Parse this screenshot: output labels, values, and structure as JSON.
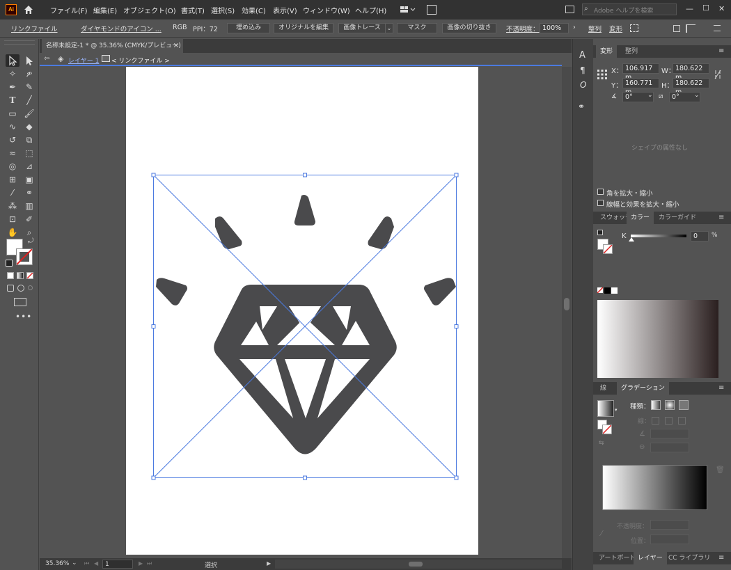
{
  "menubar": {
    "app_icon": "Ai",
    "home_icon": "home-icon",
    "items": [
      "ファイル(F)",
      "編集(E)",
      "オブジェクト(O)",
      "書式(T)",
      "選択(S)",
      "効果(C)",
      "表示(V)",
      "ウィンドウ(W)",
      "ヘルプ(H)"
    ],
    "search_placeholder": "Adobe ヘルプを検索",
    "window_controls": [
      "—",
      "☐",
      "✕"
    ]
  },
  "control_bar": {
    "linked_file": "リンクファイル",
    "file_name": "ダイヤモンドのアイコン ...",
    "color_mode": "RGB",
    "ppi": "PPI：72",
    "embed": "埋め込み",
    "edit_original": "オリジナルを編集",
    "image_trace": "画像トレース",
    "mask": "マスク",
    "crop_image": "画像の切り抜き",
    "opacity_label": "不透明度：",
    "opacity_value": "100%",
    "align": "整列",
    "transform": "変形"
  },
  "document": {
    "tab_title": "名称未設定-1 * @ 35.36% (CMYK/プレビュー)",
    "tab_close": "×",
    "breadcrumb_layer": "レイヤー 1",
    "breadcrumb_item": "< リンクファイル >"
  },
  "statusbar": {
    "zoom": "35.36%",
    "artboard_num": "1",
    "tool_name": "選択"
  },
  "transform_panel": {
    "tabs": [
      "変形",
      "整列"
    ],
    "x_label": "X：",
    "x_value": "106.917 m",
    "y_label": "Y：",
    "y_value": "160.771 m",
    "w_label": "W：",
    "w_value": "180.622 m",
    "h_label": "H：",
    "h_value": "180.622 m",
    "angle_value": "0°",
    "shear_value": "0°",
    "no_shape_props": "シェイプの属性なし",
    "scale_corners": "角を拡大・縮小",
    "scale_strokes": "線幅と効果を拡大・縮小"
  },
  "color_panel": {
    "tabs": [
      "スウォッチ",
      "カラー",
      "カラーガイド"
    ],
    "channel_label": "K",
    "channel_value": "0",
    "channel_unit": "%"
  },
  "gradient_panel": {
    "tabs": [
      "線",
      "グラデーション"
    ],
    "type_label": "種類：",
    "stroke_label": "線：",
    "opacity_label": "不透明度：",
    "position_label": "位置："
  },
  "bottom_panel": {
    "tabs": [
      "アートボード",
      "レイヤー",
      "CC ライブラリ"
    ]
  },
  "colors": {
    "accent_blue": "#4b7ae0",
    "icon_gray": "#4a4a4c",
    "artboard": "#ffffff"
  }
}
